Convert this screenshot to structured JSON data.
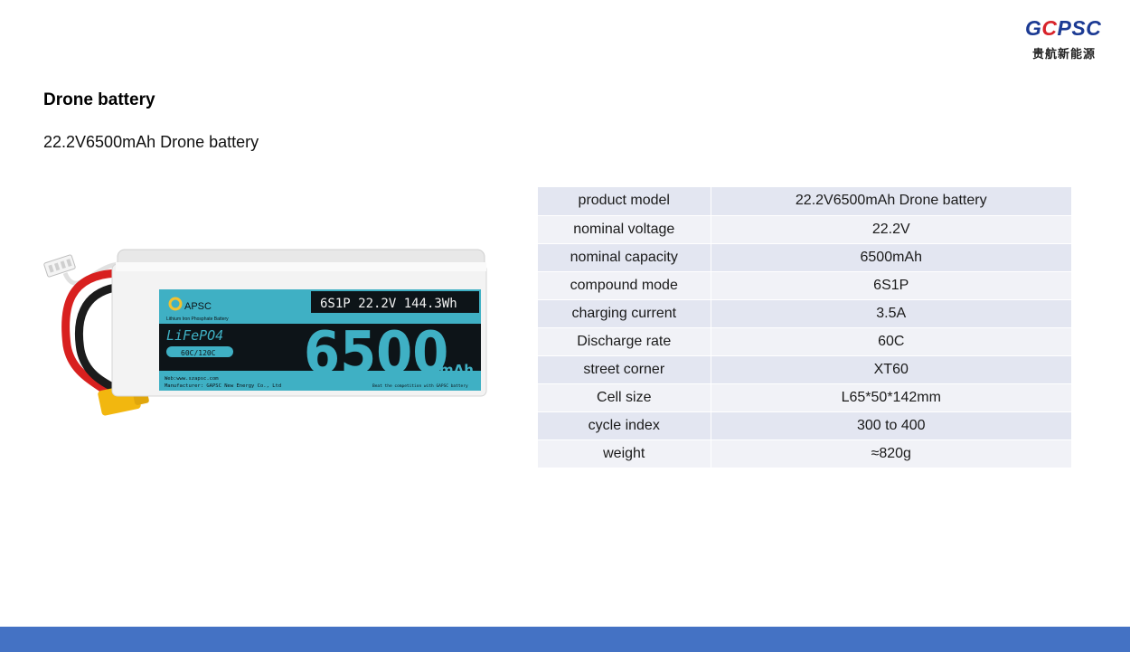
{
  "logo": {
    "mark_prefix": "G",
    "mark_circle": "C",
    "mark_suffix": "PSC",
    "subtitle": "贵航新能源"
  },
  "page": {
    "title": "Drone battery",
    "subtitle": "22.2V6500mAh Drone battery"
  },
  "battery_label": {
    "brand": "APSC",
    "chem_line": "Lithium Iron Phosphate Battery",
    "config": "6S1P  22.2V  144.3Wh",
    "chemistry": "LiFePO4",
    "rate": "60C/120C",
    "capacity": "6500",
    "unit": "mAh",
    "web": "Web:www.szapsc.com",
    "maker": "Manufacturer: GAPSC New Energy Co., Ltd",
    "slogan": "Beat the competition with GAPSC battery"
  },
  "specs": {
    "rows": [
      {
        "label": "product model",
        "value": "22.2V6500mAh Drone battery"
      },
      {
        "label": "nominal voltage",
        "value": "22.2V"
      },
      {
        "label": "nominal capacity",
        "value": "6500mAh"
      },
      {
        "label": "compound mode",
        "value": "6S1P"
      },
      {
        "label": "charging current",
        "value": "3.5A"
      },
      {
        "label": "Discharge rate",
        "value": "60C"
      },
      {
        "label": "street corner",
        "value": "XT60"
      },
      {
        "label": "Cell size",
        "value": "L65*50*142mm"
      },
      {
        "label": "cycle index",
        "value": "300 to 400"
      },
      {
        "label": "weight",
        "value": "≈820g"
      }
    ]
  },
  "colors": {
    "footer_bar": "#4472c4",
    "table_odd": "#e3e6f1",
    "table_even": "#f1f2f7",
    "label_teal": "#3fb0c4",
    "label_dark": "#0d1418",
    "connector_yellow": "#f2b70f",
    "wire_red": "#d8201f"
  }
}
